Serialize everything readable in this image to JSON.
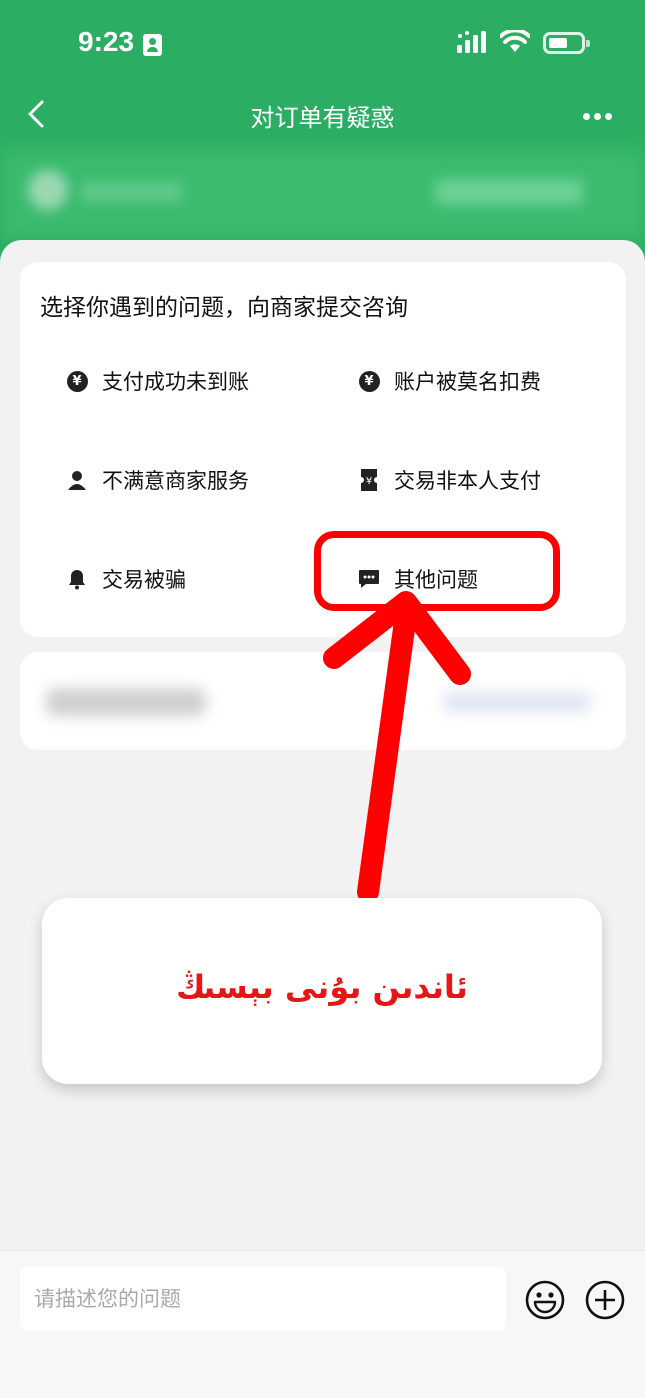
{
  "status_bar": {
    "time": "9:23"
  },
  "nav": {
    "title": "对订单有疑惑"
  },
  "card": {
    "title": "选择你遇到的问题，向商家提交咨询",
    "options": [
      {
        "label": "支付成功未到账",
        "icon": "yuan-refresh-icon"
      },
      {
        "label": "账户被莫名扣费",
        "icon": "yuan-coin-icon"
      },
      {
        "label": "不满意商家服务",
        "icon": "person-icon"
      },
      {
        "label": "交易非本人支付",
        "icon": "ticket-yuan-icon"
      },
      {
        "label": "交易被骗",
        "icon": "bell-icon"
      },
      {
        "label": "其他问题",
        "icon": "chat-bubble-icon"
      }
    ]
  },
  "callout": {
    "text": "ئاندىن بۇنى بېسىڭ"
  },
  "input": {
    "placeholder": "请描述您的问题"
  },
  "colors": {
    "brand_green": "#2bae63",
    "annotation_red": "#ff0000"
  }
}
